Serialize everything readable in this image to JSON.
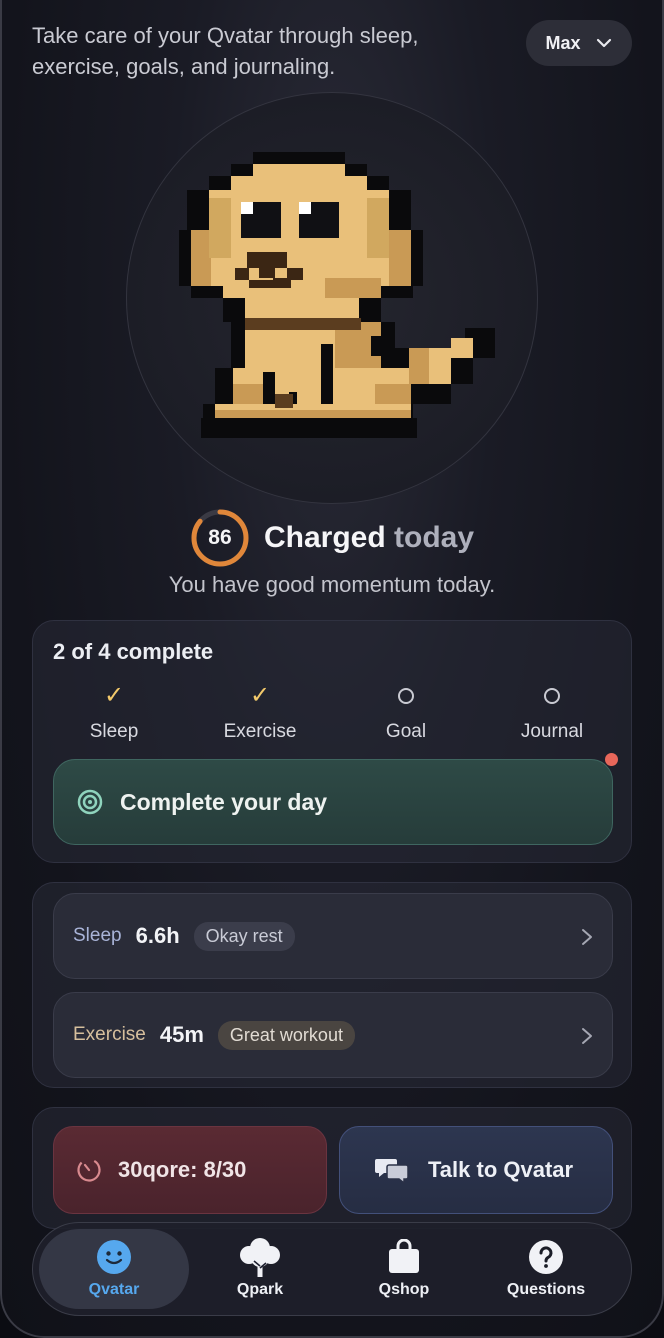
{
  "header": {
    "subtitle": "Take care of your Qvatar through sleep, exercise, goals, and journaling.",
    "profile_name": "Max",
    "profile_icon": "chevron-down-icon"
  },
  "status": {
    "score": "86",
    "score_fraction": 0.86,
    "title_strong": "Charged",
    "title_muted": "today",
    "message": "You have good momentum today."
  },
  "progress": {
    "summary": "2 of 4 complete",
    "tasks": [
      {
        "label": "Sleep",
        "done": true
      },
      {
        "label": "Exercise",
        "done": true
      },
      {
        "label": "Goal",
        "done": false
      },
      {
        "label": "Journal",
        "done": false
      }
    ],
    "check_glyph": "✓",
    "cta_label": "Complete your day",
    "cta_icon": "target-icon"
  },
  "metrics": {
    "sleep": {
      "label": "Sleep",
      "value": "6.6h",
      "badge": "Okay rest"
    },
    "exercise": {
      "label": "Exercise",
      "value": "45m",
      "badge": "Great workout"
    }
  },
  "actions": {
    "qore_label": "30qore: 8/30",
    "qore_icon": "timer-icon",
    "talk_label": "Talk to Qvatar",
    "talk_icon": "chat-bubbles-icon"
  },
  "tabs": [
    {
      "label": "Qvatar",
      "icon": "smiley-icon",
      "active": true
    },
    {
      "label": "Qpark",
      "icon": "tree-icon",
      "active": false
    },
    {
      "label": "Qshop",
      "icon": "shopping-bag-icon",
      "active": false
    },
    {
      "label": "Questions",
      "icon": "question-icon",
      "active": false
    }
  ],
  "colors": {
    "accent_orange": "#e0873a",
    "accent_blue": "#56a8ee",
    "check_gold": "#f2c96b",
    "notification": "#e8675a",
    "dog_fur": "#e9c07a"
  }
}
